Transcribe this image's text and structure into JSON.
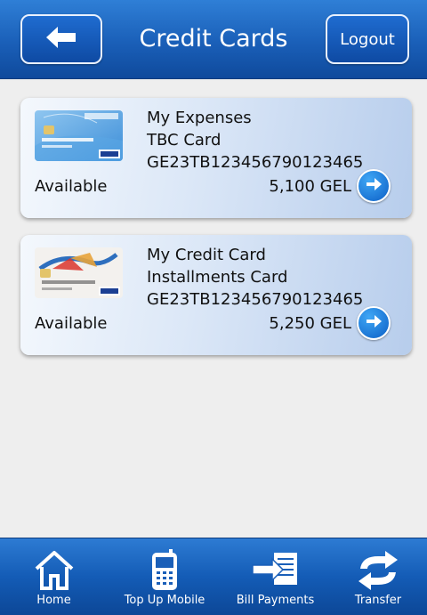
{
  "header": {
    "title": "Credit Cards",
    "logout_label": "Logout"
  },
  "cards": [
    {
      "name": "My Expenses",
      "type": "TBC Card",
      "account": "GE23TB123456790123465",
      "available_label": "Available",
      "amount": "5,100 GEL"
    },
    {
      "name": "My Credit Card",
      "type": "Installments Card",
      "account": "GE23TB123456790123465",
      "available_label": "Available",
      "amount": "5,250 GEL"
    }
  ],
  "tabbar": {
    "tabs": [
      {
        "label": "Home",
        "icon": "house-icon"
      },
      {
        "label": "Top Up Mobile",
        "icon": "mobile-phone-icon"
      },
      {
        "label": "Bill Payments",
        "icon": "bill-payment-icon"
      },
      {
        "label": "Transfer",
        "icon": "transfer-arrows-icon"
      }
    ]
  },
  "colors": {
    "header_blue": "#1a5fb8",
    "background": "#eeeeee",
    "card_gradient_end": "#b7cdec",
    "accent_button": "#0c5fc6"
  }
}
